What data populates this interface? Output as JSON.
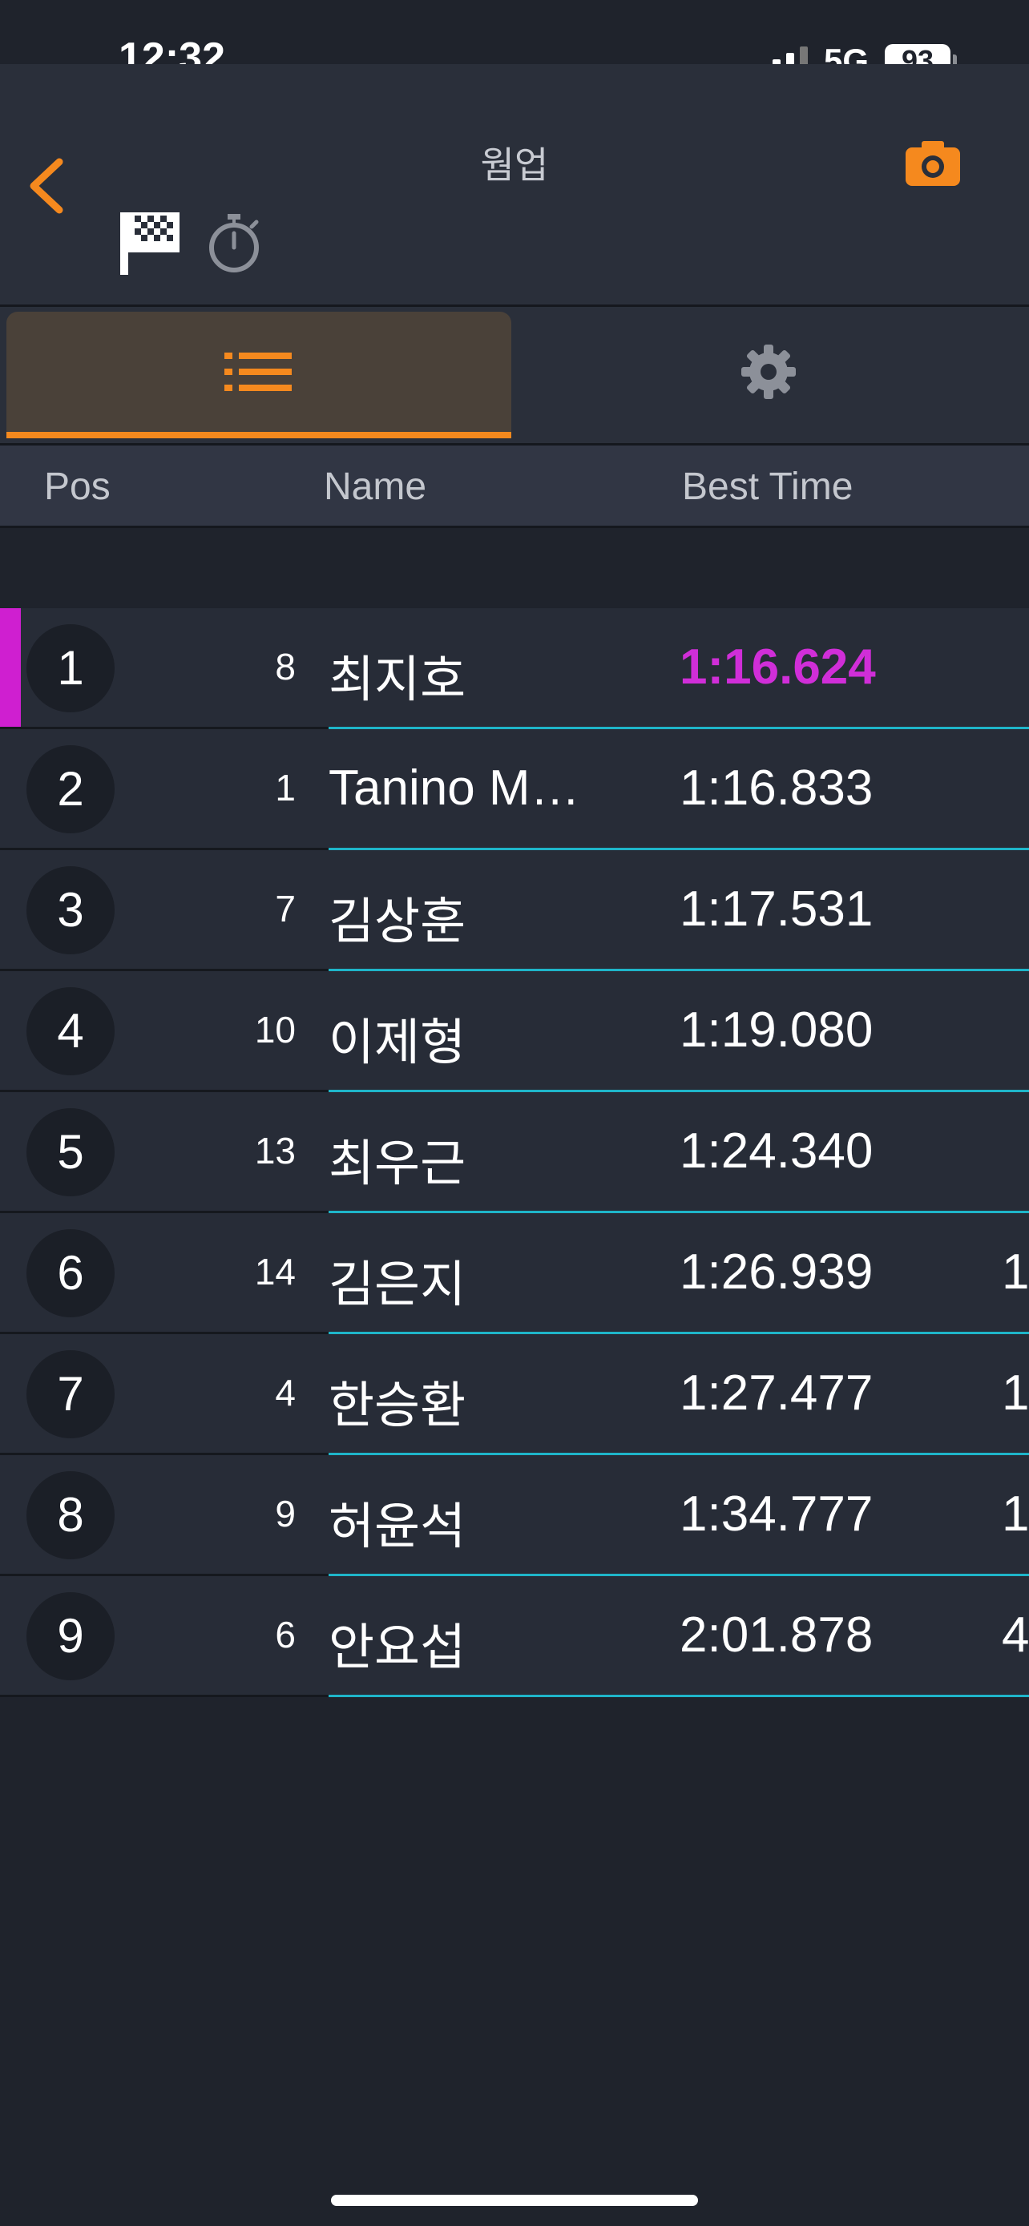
{
  "status_bar": {
    "time": "12:32",
    "network": "5G",
    "battery": "93"
  },
  "header": {
    "title": "웜업"
  },
  "columns": {
    "pos": "Pos",
    "name": "Name",
    "best_time": "Best Time"
  },
  "rows": [
    {
      "pos": "1",
      "car": "8",
      "name": "최지호",
      "time": "1:16.624",
      "extra": "",
      "fastest": true
    },
    {
      "pos": "2",
      "car": "1",
      "name": "Tanino M…",
      "time": "1:16.833",
      "extra": ""
    },
    {
      "pos": "3",
      "car": "7",
      "name": "김상훈",
      "time": "1:17.531",
      "extra": ""
    },
    {
      "pos": "4",
      "car": "10",
      "name": "이제형",
      "time": "1:19.080",
      "extra": ""
    },
    {
      "pos": "5",
      "car": "13",
      "name": "최우근",
      "time": "1:24.340",
      "extra": ""
    },
    {
      "pos": "6",
      "car": "14",
      "name": "김은지",
      "time": "1:26.939",
      "extra": "1"
    },
    {
      "pos": "7",
      "car": "4",
      "name": "한승환",
      "time": "1:27.477",
      "extra": "1"
    },
    {
      "pos": "8",
      "car": "9",
      "name": "허윤석",
      "time": "1:34.777",
      "extra": "1"
    },
    {
      "pos": "9",
      "car": "6",
      "name": "안요섭",
      "time": "2:01.878",
      "extra": "4"
    }
  ],
  "colors": {
    "accent": "#f5891e",
    "fastest": "#d02ed8",
    "divider": "#1fb5c9"
  }
}
